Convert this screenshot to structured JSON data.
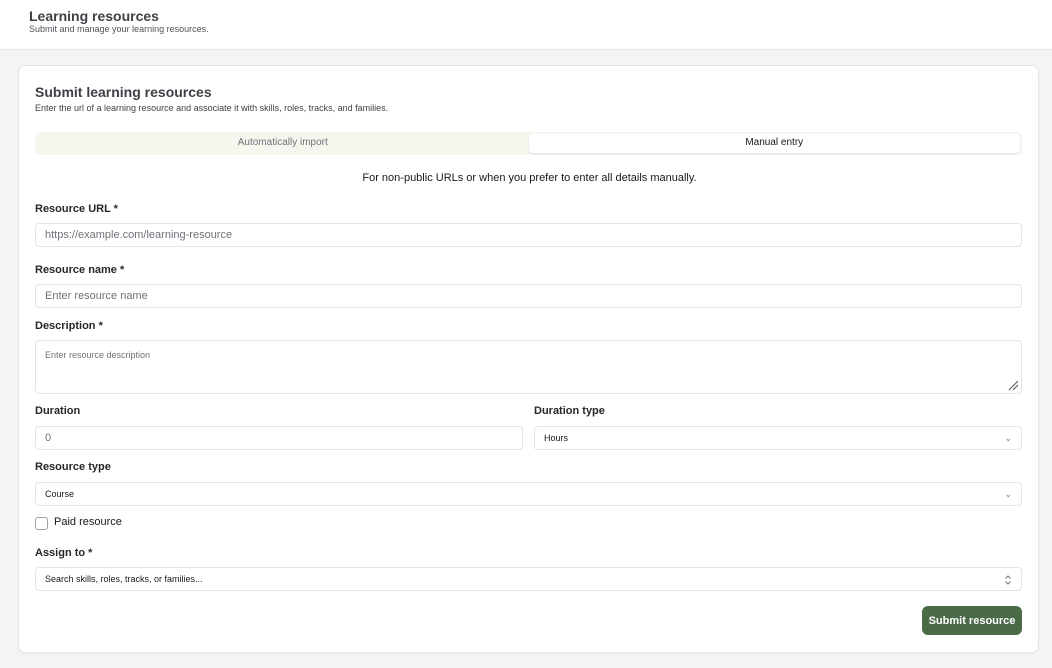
{
  "header": {
    "title": "Learning resources",
    "subtitle": "Submit and manage your learning resources."
  },
  "form": {
    "title": "Submit learning resources",
    "description": "Enter the url of a learning resource and associate it with skills, roles, tracks, and families.",
    "tabs": [
      {
        "label": "Automatically import",
        "active": false
      },
      {
        "label": "Manual entry",
        "active": true
      }
    ],
    "hint": "For non-public URLs or when you prefer to enter all details manually.",
    "resource_url": {
      "label": "Resource URL *",
      "placeholder": "https://example.com/learning-resource",
      "value": ""
    },
    "resource_name": {
      "label": "Resource name *",
      "placeholder": "Enter resource name",
      "value": ""
    },
    "description_field": {
      "label": "Description *",
      "placeholder": "Enter resource description",
      "value": ""
    },
    "duration": {
      "label": "Duration",
      "placeholder": "0",
      "value": ""
    },
    "duration_type": {
      "label": "Duration type",
      "value": "Hours"
    },
    "resource_type": {
      "label": "Resource type",
      "value": "Course"
    },
    "paid": {
      "label": "Paid resource",
      "checked": false
    },
    "assign_to": {
      "label": "Assign to *",
      "placeholder": "Search skills, roles, tracks, or families..."
    },
    "submit_label": "Submit resource"
  },
  "colors": {
    "accent": "#4b6b48",
    "tab_track": "#f3f7ee"
  }
}
